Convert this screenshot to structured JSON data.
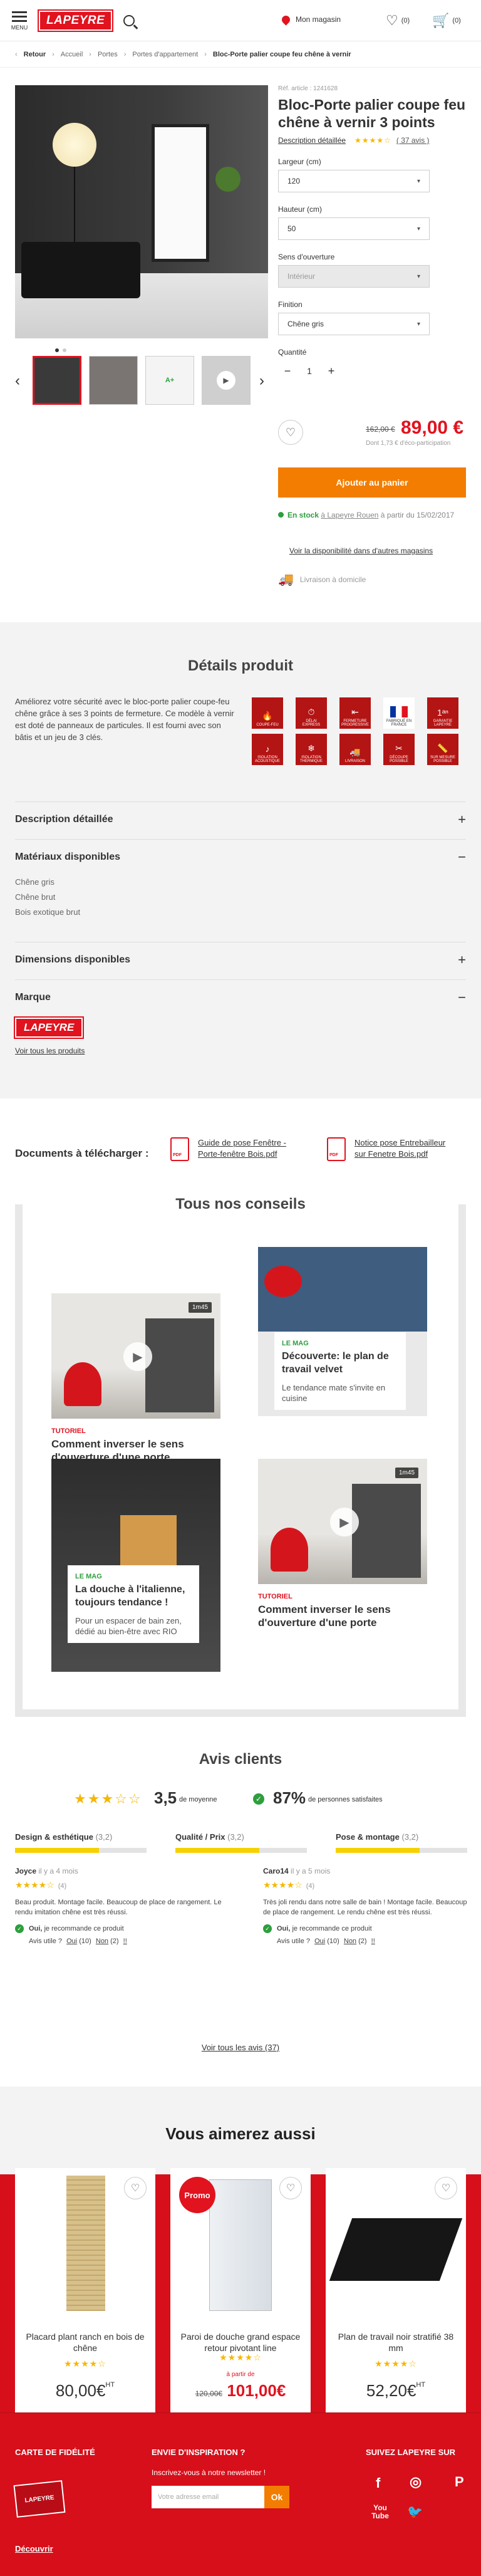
{
  "header": {
    "menu_label": "MENU",
    "logo": "LAPEYRE",
    "store_label": "Mon magasin",
    "fav_count": "(0)",
    "cart_count": "(0)"
  },
  "breadcrumb": {
    "back": "Retour",
    "items": [
      "Accueil",
      "Portes",
      "Portes d'appartement"
    ],
    "current": "Bloc-Porte palier coupe feu chêne à vernir"
  },
  "product": {
    "ref": "Réf. article : 1241628",
    "title": "Bloc-Porte palier coupe feu chêne à vernir 3 points",
    "desc_link": "Description détaillée",
    "rating_stars": "★★★★☆",
    "reviews_link": "( 37 avis )",
    "largeur_label": "Largeur (cm)",
    "largeur_value": "120",
    "hauteur_label": "Hauteur (cm)",
    "hauteur_value": "50",
    "sens_label": "Sens d'ouverture",
    "sens_value": "Intérieur",
    "finition_label": "Finition",
    "finition_value": "Chêne gris",
    "quantite_label": "Quantité",
    "quantite_value": "1",
    "old_price": "162,00 €",
    "price": "89,00 €",
    "eco": "Dont 1,73 € d'éco-participation",
    "add_to_cart": "Ajouter au panier",
    "stock_status": "En stock",
    "stock_store": "à Lapeyre Rouen",
    "stock_date": "à partir du 15/02/2017",
    "dispo_link": "Voir la disponibilité dans d'autres magasins",
    "livraison": "Livraison à domicile"
  },
  "details": {
    "title": "Détails produit",
    "text": "Améliorez votre sécurité avec le bloc-porte palier coupe-feu chêne grâce à ses 3 points de fermeture. Ce modèle à vernir est doté de panneaux de particules. Il est fourni avec son bâtis et un jeu de 3 clés.",
    "badges": [
      "COUPE-FEU",
      "DÉLAI EXPRESS",
      "FERMETURE PROGRESSIVE",
      "FABRIQUÉ EN FRANCE",
      "GARANTIE LAPEYRE",
      "ISOLATION ACOUSTIQUE",
      "ISOLATION THERMIQUE",
      "LIVRAISON",
      "DÉCOUPE POSSIBLE",
      "SUR MESURE POSSIBLE"
    ],
    "acc_desc": "Description détaillée",
    "acc_materiaux": "Matériaux disponibles",
    "materiaux": [
      "Chêne gris",
      "Chêne brut",
      "Bois exotique brut"
    ],
    "acc_dimensions": "Dimensions disponibles",
    "acc_marque": "Marque",
    "marque_logo": "LAPEYRE",
    "voir_tous": "Voir tous les produits"
  },
  "documents": {
    "title": "Documents à télécharger :",
    "doc1": "Guide de pose Fenêtre - Porte-fenêtre Bois.pdf",
    "doc2": "Notice pose Entrebailleur sur Fenetre Bois.pdf"
  },
  "conseils": {
    "title": "Tous nos conseils",
    "card1_tag": "TUTORIEL",
    "card1_title": "Comment inverser le sens d'ouverture  d'une porte",
    "card1_duration": "1m45",
    "card2_tag": "LE MAG",
    "card2_title": "Découverte: le plan de travail velvet",
    "card2_sub": "Le tendance mate s'invite en cuisine",
    "card3_tag": "LE MAG",
    "card3_title": "La douche à l'italienne, toujours tendance !",
    "card3_sub": "Pour un espacer de bain zen, dédié au bien-être avec RIO",
    "card4_tag": "TUTORIEL",
    "card4_title": "Comment inverser le sens d'ouverture  d'une porte",
    "card4_duration": "1m45"
  },
  "avis": {
    "title": "Avis clients",
    "stars": "★★★☆☆",
    "note": "3,5",
    "moyenne": "de moyenne",
    "pct": "87%",
    "satisfaits": "de personnes satisfaites",
    "criteres": [
      {
        "label": "Design & esthétique",
        "value": "(3,2)",
        "fill": 0.64
      },
      {
        "label": "Qualité / Prix",
        "value": "(3,2)",
        "fill": 0.64
      },
      {
        "label": "Pose & montage",
        "value": "(3,2)",
        "fill": 0.64
      }
    ],
    "r1_name": "Joyce",
    "r1_ago": "il y a 4 mois",
    "r1_stars": "★★★★☆",
    "r1_score": "(4)",
    "r1_text": "Beau produit. Montage facile. Beaucoup de place de rangement. Le rendu imitation chêne est très réussi.",
    "r2_name": "Caro14",
    "r2_ago": "il y a 5 mois",
    "r2_stars": "★★★★☆",
    "r2_score": "(4)",
    "r2_text": "Très joli rendu dans notre salle de bain ! Montage facile. Beaucoup de place de rangement. Le rendu chêne est très réussi.",
    "rec_yes": "Oui,",
    "rec_text": "je recommande ce produit",
    "utile": "Avis utile ?",
    "oui": "Oui",
    "oui_count": "(10)",
    "non": "Non",
    "non_count": "(2)",
    "report": "!!",
    "voir": "Voir tous les avis (37)"
  },
  "aimez": {
    "title": "Vous aimerez aussi",
    "p1_name": "Placard plant ranch en bois de chêne",
    "p1_price": "80,00€",
    "p1_ht": "HT",
    "p2_promo": "Promo",
    "p2_name": "Paroi de douche grand espace retour pivotant line",
    "p2_apartir": "à partir de",
    "p2_old": "120,00€",
    "p2_price": "101,00€",
    "p3_name": "Plan de travail noir stratifié 38 mm",
    "p3_price": "52,20€",
    "p3_ht": "HT",
    "stars": "★★★★☆"
  },
  "footer": {
    "fidelite": "CARTE DE FIDÉLITÉ",
    "card_text": "LAPEYRE",
    "decouvrir": "Découvrir",
    "inspiration": "ENVIE D'INSPIRATION ?",
    "newsletter": "Inscrivez-vous à notre newsletter !",
    "email_placeholder": "Votre adresse email",
    "ok": "Ok",
    "suivez": "SUIVEZ LAPEYRE SUR",
    "socials": [
      "f",
      "◎",
      "P",
      "You Tube",
      "🐦"
    ]
  },
  "colors": {
    "brand": "#e1131f",
    "accent": "#f27d00",
    "success": "#2e9e3e",
    "star": "#f6b700"
  },
  "icons": [
    "menu-icon",
    "search-icon",
    "location-pin-icon",
    "heart-icon",
    "cart-icon",
    "chevron-down-icon",
    "play-icon",
    "pdf-icon",
    "truck-icon",
    "check-icon"
  ]
}
